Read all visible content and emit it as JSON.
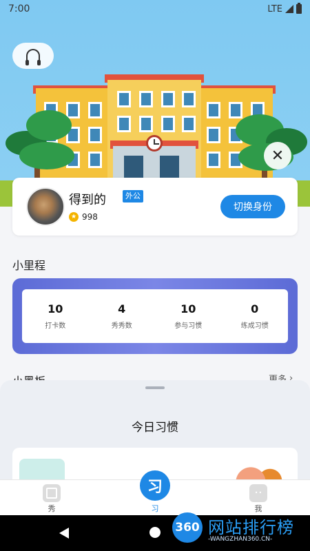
{
  "status_bar": {
    "time": "7:00",
    "network": "LTE"
  },
  "header": {
    "support_icon": "headset-icon",
    "close_icon": "close-icon",
    "close_symbol": "✕"
  },
  "profile": {
    "name": "得到的",
    "role_badge": "外公",
    "points": "998",
    "coin_icon": "coin-icon",
    "switch_role_label": "切换身份"
  },
  "mileage": {
    "title": "小里程",
    "stats": [
      {
        "value": "10",
        "label": "打卡数"
      },
      {
        "value": "4",
        "label": "秀秀数"
      },
      {
        "value": "10",
        "label": "参与习惯"
      },
      {
        "value": "0",
        "label": "练成习惯"
      }
    ]
  },
  "blackboard": {
    "title": "小黑板",
    "more_label": "更多",
    "more_symbol": "›"
  },
  "sheet": {
    "title": "今日习惯"
  },
  "tabs": [
    {
      "label": "秀",
      "icon": "book-icon",
      "active": false
    },
    {
      "label": "习",
      "icon": "habit-icon",
      "glyph": "习",
      "active": true
    },
    {
      "label": "我",
      "icon": "face-icon",
      "active": false
    }
  ],
  "watermark": {
    "badge": "360",
    "text": "网站排行榜",
    "sub": "-WANGZHAN360.CN-"
  },
  "colors": {
    "accent": "#1e88e5",
    "mileage": "#5c6bd6",
    "sky": "#7fc9f2"
  }
}
